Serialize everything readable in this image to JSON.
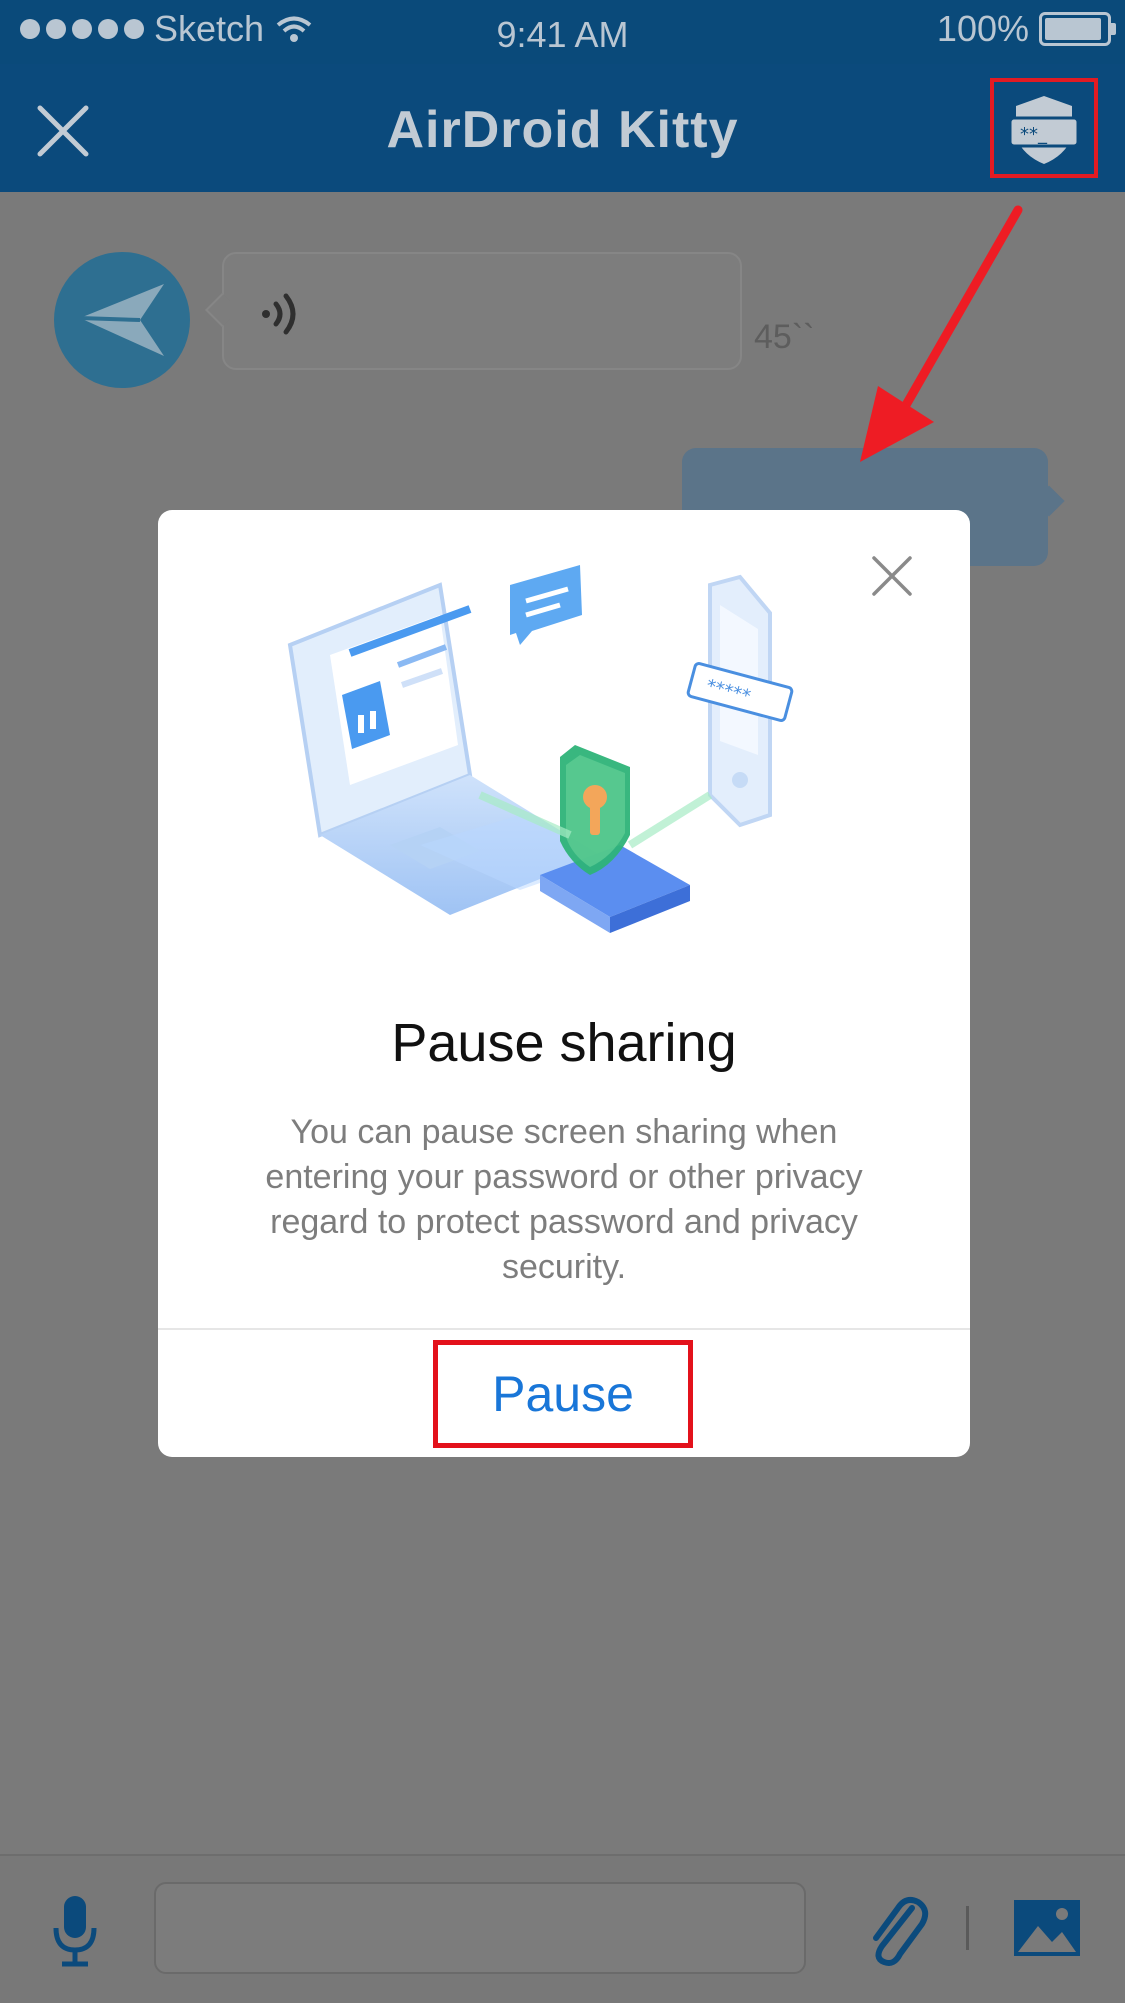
{
  "status_bar": {
    "carrier": "Sketch",
    "time": "9:41 AM",
    "battery": "100%"
  },
  "nav": {
    "title": "AirDroid Kitty"
  },
  "chat": {
    "voice_duration": "45``"
  },
  "modal": {
    "title": "Pause sharing",
    "body": "You can pause screen sharing when entering your password or other privacy regard to protect password and privacy security.",
    "button": "Pause"
  },
  "colors": {
    "nav_bg": "#0b4a7c",
    "accent": "#1976d8",
    "highlight": "#e3111b"
  },
  "icons": [
    "close-icon",
    "shield-password-icon",
    "paper-plane-icon",
    "sound-wave-icon",
    "microphone-icon",
    "paperclip-icon",
    "image-icon"
  ]
}
